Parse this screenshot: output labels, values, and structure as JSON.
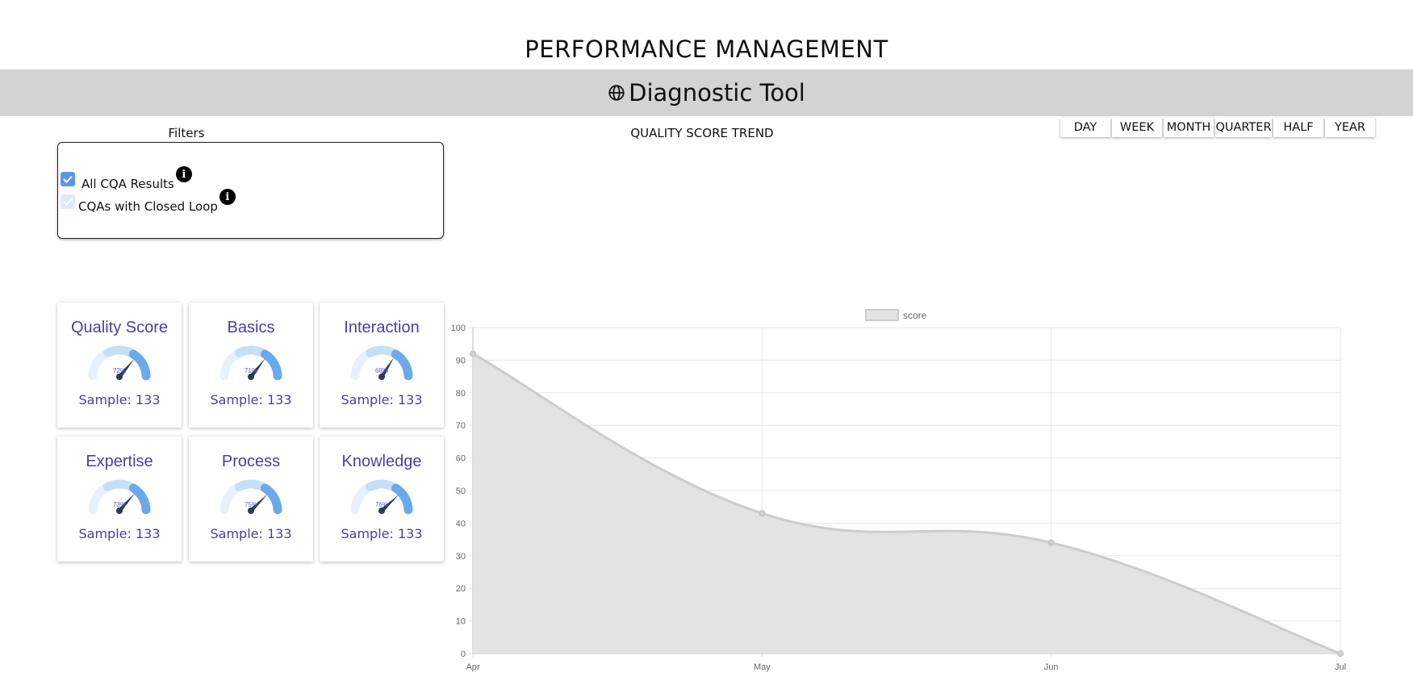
{
  "header": {
    "title": "PERFORMANCE MANAGEMENT",
    "banner_title": "Diagnostic Tool",
    "banner_icon": "globe-icon",
    "banner_bg": "#d3d3d3"
  },
  "filters": {
    "title": "Filters",
    "items": [
      {
        "label": "All CQA Results",
        "checked": true,
        "icon": "info-icon"
      },
      {
        "label": "CQAs with Closed Loop",
        "checked": true,
        "disabled": true,
        "icon": "info-icon"
      }
    ]
  },
  "trend": {
    "title": "QUALITY SCORE TREND",
    "periods": [
      "DAY",
      "WEEK",
      "MONTH",
      "QUARTER",
      "HALF",
      "YEAR"
    ]
  },
  "cards": [
    {
      "title": "Quality Score",
      "percent": "72%",
      "value": 72,
      "sample": "Sample: 133"
    },
    {
      "title": "Basics",
      "percent": "71%",
      "value": 71,
      "sample": "Sample: 133"
    },
    {
      "title": "Interaction",
      "percent": "68%",
      "value": 68,
      "sample": "Sample: 133"
    },
    {
      "title": "Expertise",
      "percent": "73%",
      "value": 73,
      "sample": "Sample: 133"
    },
    {
      "title": "Process",
      "percent": "75%",
      "value": 75,
      "sample": "Sample: 133"
    },
    {
      "title": "Knowledge",
      "percent": "76%",
      "value": 76,
      "sample": "Sample: 133"
    }
  ],
  "colors": {
    "card_text": "#4a3fa3",
    "gauge_light": "#e6f1fc",
    "gauge_mid": "#c4e0f7",
    "gauge_dark": "#6aa9ea",
    "area_fill": "#e3e3e3",
    "area_line": "#cccccc"
  },
  "chart_data": {
    "type": "area",
    "categories": [
      "Apr",
      "May",
      "Jun",
      "Jul"
    ],
    "series": [
      {
        "name": "score",
        "values": [
          92,
          43,
          34,
          0
        ]
      }
    ],
    "ylim": [
      0,
      100
    ],
    "yticks": [
      0,
      10,
      20,
      30,
      40,
      50,
      60,
      70,
      80,
      90,
      100
    ],
    "grid": true,
    "legend": "top-center"
  }
}
